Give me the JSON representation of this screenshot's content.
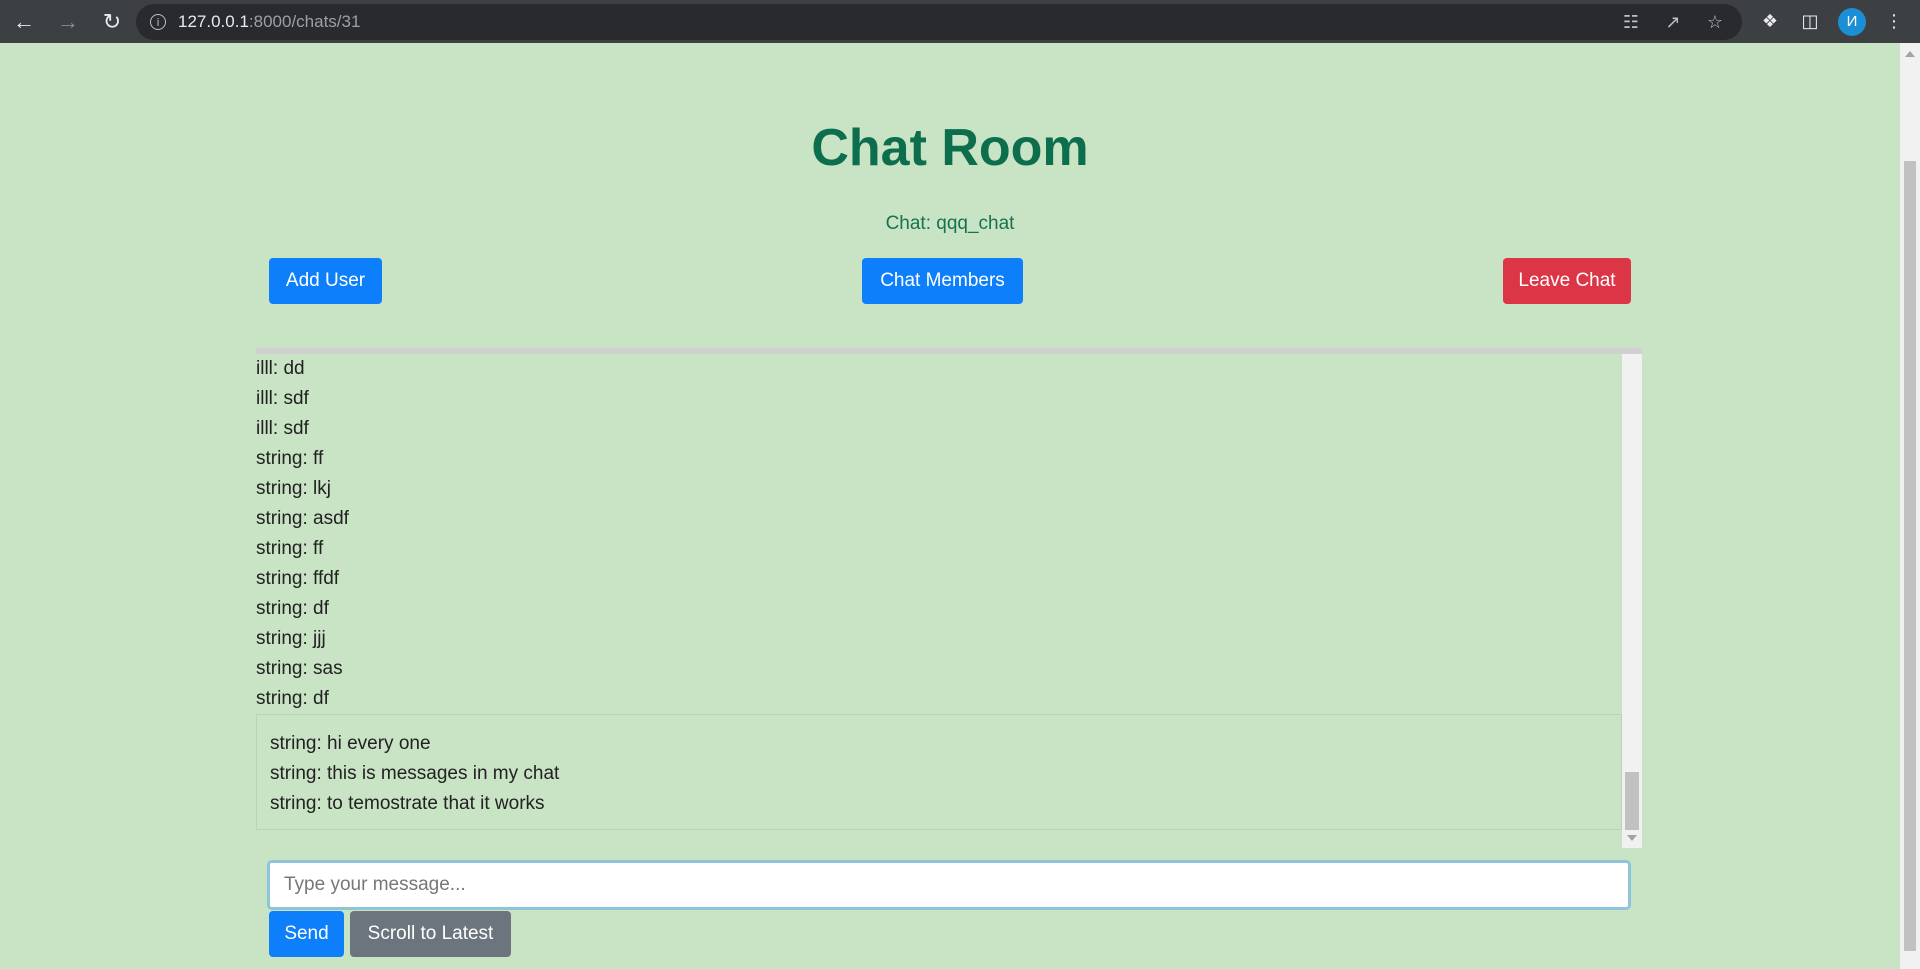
{
  "browser": {
    "url_host": "127.0.0.1",
    "url_rest": ":8000/chats/31",
    "profile_initial": "И"
  },
  "page": {
    "title": "Chat Room",
    "chat_label": "Chat: qqq_chat"
  },
  "buttons": {
    "add_user": "Add User",
    "chat_members": "Chat Members",
    "leave_chat": "Leave Chat",
    "send": "Send",
    "scroll_latest": "Scroll to Latest"
  },
  "messages": [
    "illl: dd",
    "illl: sdf",
    "illl: sdf",
    "string: ff",
    "string: lkj",
    "string: asdf",
    "string: ff",
    "string: ffdf",
    "string: df",
    "string: jjj",
    "string: sas",
    "string: df"
  ],
  "latest_messages": [
    "string: hi every one",
    "string: this is messages in my chat",
    "string: to temostrate that it works"
  ],
  "input": {
    "placeholder": "Type your message..."
  },
  "colors": {
    "background": "#c9e3c5",
    "title": "#0d6e4e",
    "primary": "#0d7ffb",
    "danger": "#dc3545",
    "secondary": "#6c757d"
  }
}
